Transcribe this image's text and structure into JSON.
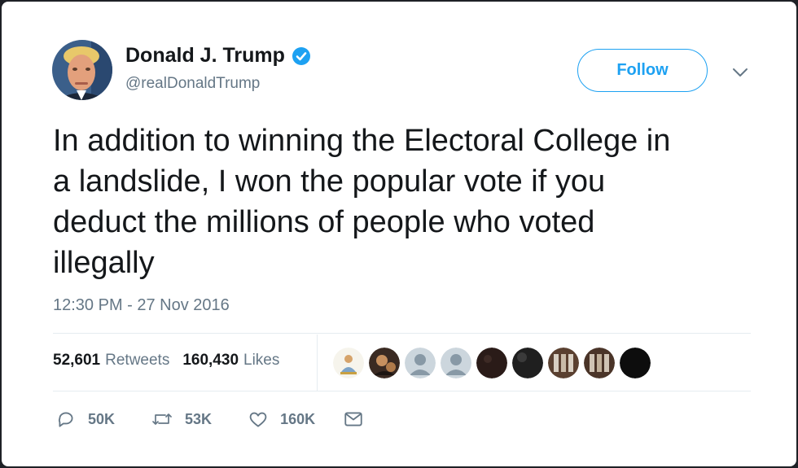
{
  "tweet": {
    "author_name": "Donald J. Trump",
    "author_handle": "@realDonaldTrump",
    "follow_label": "Follow",
    "text_lines": [
      "In addition to winning the Electoral College in",
      "a landslide, I won the popular vote if you",
      "deduct the millions of people who voted",
      "illegally"
    ],
    "timestamp": "12:30 PM - 27 Nov 2016"
  },
  "stats": {
    "retweets_count": "52,601",
    "retweets_label": "Retweets",
    "likes_count": "160,430",
    "likes_label": "Likes"
  },
  "liker_avatars": [
    "avatar-1",
    "avatar-2",
    "avatar-3",
    "avatar-4",
    "avatar-5",
    "avatar-6",
    "avatar-7",
    "avatar-8",
    "avatar-9"
  ],
  "actions": {
    "reply_count": "50K",
    "retweet_count": "53K",
    "like_count": "160K"
  },
  "icons": {
    "verified": "verified-badge-icon",
    "caret": "chevron-down-icon",
    "reply": "reply-icon",
    "retweet": "retweet-icon",
    "like": "heart-icon",
    "dm": "envelope-icon"
  },
  "colors": {
    "accent": "#1da1f2",
    "text": "#14171a",
    "muted": "#657786"
  }
}
